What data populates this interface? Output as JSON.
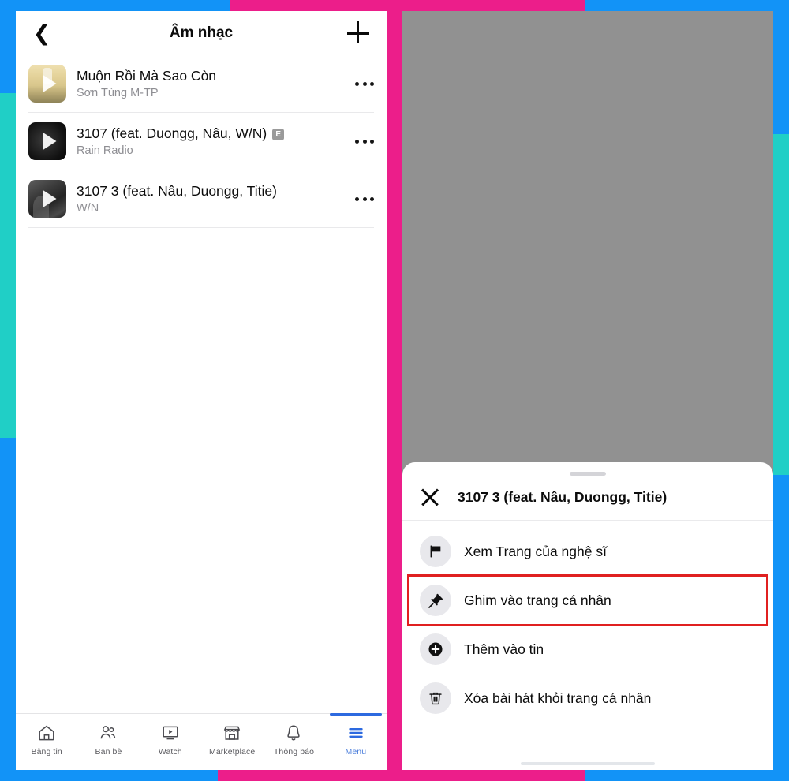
{
  "colors": {
    "border_blue": "#1293f7",
    "border_pink": "#ec1e8a",
    "border_teal": "#20cfc6",
    "highlight_red": "#e02020",
    "nav_active_blue": "#2d6ae0",
    "dim_gray": "#919191"
  },
  "app": {
    "screen_title": "Âm nhạc",
    "back_icon": "chevron-left-icon",
    "add_icon": "plus-icon"
  },
  "songs": [
    {
      "title": "Muộn Rồi Mà Sao Còn",
      "artist": "Sơn Tùng M-TP",
      "explicit": false,
      "thumb_class": "t-gold",
      "more_icon": "more-horizontal-icon"
    },
    {
      "title": "3107 (feat. Duongg, Nâu, W/N)",
      "artist": "Rain Radio",
      "explicit": true,
      "explicit_badge": "E",
      "thumb_class": "t-black",
      "more_icon": "more-horizontal-icon"
    },
    {
      "title": "3107 3 (feat. Nâu, Duongg, Titie)",
      "artist": "W/N",
      "explicit": false,
      "thumb_class": "t-gray",
      "more_icon": "more-horizontal-icon"
    }
  ],
  "bottom_nav": [
    {
      "label": "Bảng tin",
      "icon": "home-icon",
      "active": false
    },
    {
      "label": "Bạn bè",
      "icon": "friends-icon",
      "active": false
    },
    {
      "label": "Watch",
      "icon": "video-icon",
      "active": false
    },
    {
      "label": "Marketplace",
      "icon": "storefront-icon",
      "active": false
    },
    {
      "label": "Thông báo",
      "icon": "bell-icon",
      "active": false
    },
    {
      "label": "Menu",
      "icon": "hamburger-icon",
      "active": true
    }
  ],
  "sheet": {
    "title": "3107 3 (feat. Nâu, Duongg, Titie)",
    "close_icon": "close-icon",
    "grabber": "drag-handle",
    "items": [
      {
        "label": "Xem Trang của nghệ sĩ",
        "icon": "flag-icon",
        "highlighted": false
      },
      {
        "label": "Ghim vào trang cá nhân",
        "icon": "pin-icon",
        "highlighted": true
      },
      {
        "label": "Thêm vào tin",
        "icon": "plus-circle-icon",
        "highlighted": false
      },
      {
        "label": "Xóa bài hát khỏi trang cá nhân",
        "icon": "trash-icon",
        "highlighted": false
      }
    ]
  }
}
